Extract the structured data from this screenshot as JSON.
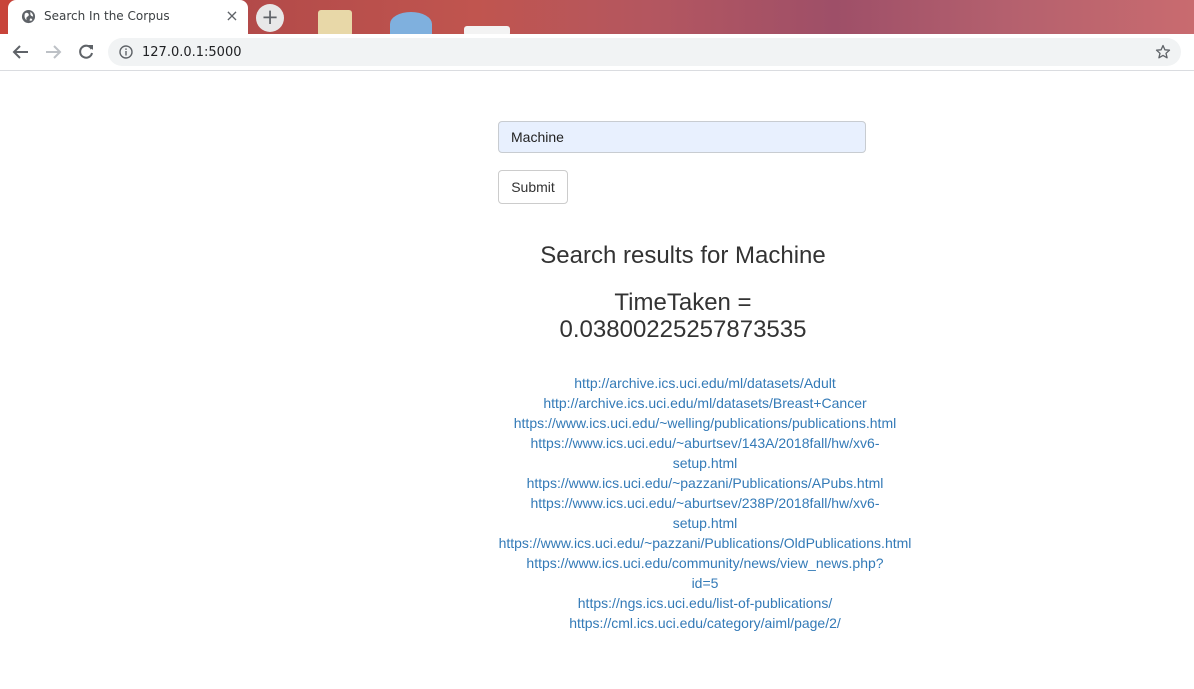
{
  "browser": {
    "tab_title": "Search In the Corpus",
    "tab_close": "×",
    "new_tab": "+",
    "url": "127.0.0.1:5000"
  },
  "search": {
    "value": "Machine",
    "submit_label": "Submit"
  },
  "results": {
    "title": "Search results for Machine",
    "time_label": "TimeTaken =",
    "time_value": "0.03800225257873535",
    "links": [
      {
        "line1": "http://archive.ics.uci.edu/ml/datasets/Adult",
        "line2": ""
      },
      {
        "line1": "http://archive.ics.uci.edu/ml/datasets/Breast+Cancer",
        "line2": ""
      },
      {
        "line1": "https://www.ics.uci.edu/~welling/publications/publications.html",
        "line2": ""
      },
      {
        "line1": "https://www.ics.uci.edu/~aburtsev/143A/2018fall/hw/xv6-",
        "line2": "setup.html"
      },
      {
        "line1": "https://www.ics.uci.edu/~pazzani/Publications/APubs.html",
        "line2": ""
      },
      {
        "line1": "https://www.ics.uci.edu/~aburtsev/238P/2018fall/hw/xv6-",
        "line2": "setup.html"
      },
      {
        "line1": "https://www.ics.uci.edu/~pazzani/Publications/OldPublications.html",
        "line2": ""
      },
      {
        "line1": "https://www.ics.uci.edu/community/news/view_news.php?",
        "line2": "id=5"
      },
      {
        "line1": "https://ngs.ics.uci.edu/list-of-publications/",
        "line2": ""
      },
      {
        "line1": "https://cml.ics.uci.edu/category/aiml/page/2/",
        "line2": ""
      }
    ]
  },
  "colors": {
    "link": "#337ab7",
    "input_bg": "#e8f0fe"
  }
}
